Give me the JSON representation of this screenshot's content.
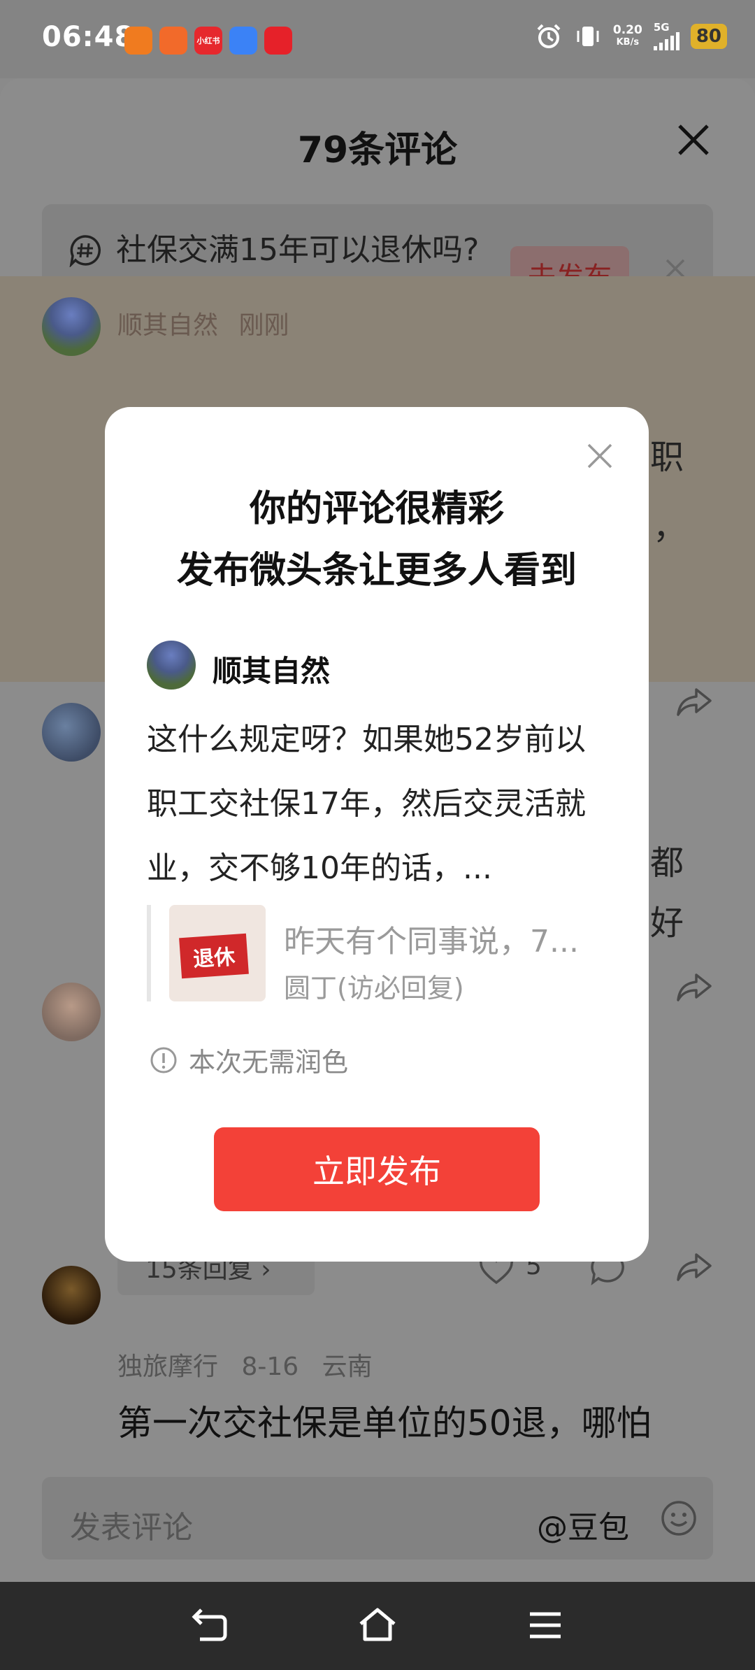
{
  "status_bar": {
    "time": "06:48",
    "app_icons": [
      {
        "name": "orange-app-icon",
        "color": "#f07b1f",
        "label": ""
      },
      {
        "name": "grid-app-icon",
        "color": "#f26a2a",
        "label": ""
      },
      {
        "name": "xiaohongshu-app-icon",
        "color": "#e6282d",
        "label": "小红书"
      },
      {
        "name": "docs-app-icon",
        "color": "#3b82f6",
        "label": ""
      },
      {
        "name": "red-app-icon",
        "color": "#e62129",
        "label": ""
      }
    ],
    "net_speed_value": "0.20",
    "net_speed_unit": "KB/s",
    "network": "5G",
    "battery": "80"
  },
  "sheet": {
    "title": "79条评论",
    "topic": {
      "text": "社保交满15年可以退休吗?",
      "button": "去发布"
    }
  },
  "comments": [
    {
      "author": "顺其自然",
      "time": "刚刚",
      "fragments": [
        "职",
        "，"
      ]
    },
    {
      "fragments": [
        "都",
        "好"
      ]
    },
    {
      "reply_count": "15条回复 ›",
      "likes": "5"
    },
    {
      "author": "独旅摩行",
      "time": "8-16",
      "location": "云南",
      "text": "第一次交社保是单位的50退，哪怕"
    }
  ],
  "input": {
    "placeholder": "发表评论",
    "mention": "@豆包"
  },
  "dialog": {
    "title_line1": "你的评论很精彩",
    "title_line2": "发布微头条让更多人看到",
    "author": "顺其自然",
    "body": "这什么规定呀？如果她52岁前以职工交社保17年，然后交灵活就业，交不够10年的话，...",
    "ref_image_text": "退休",
    "ref_title": "昨天有个同事说，7...",
    "ref_sub": "圆丁(访必回复)",
    "note": "本次无需润色",
    "publish_button": "立即发布"
  },
  "colors": {
    "accent": "#f34138",
    "overlay": "#8c8c8c",
    "highlight": "#8b8376"
  }
}
